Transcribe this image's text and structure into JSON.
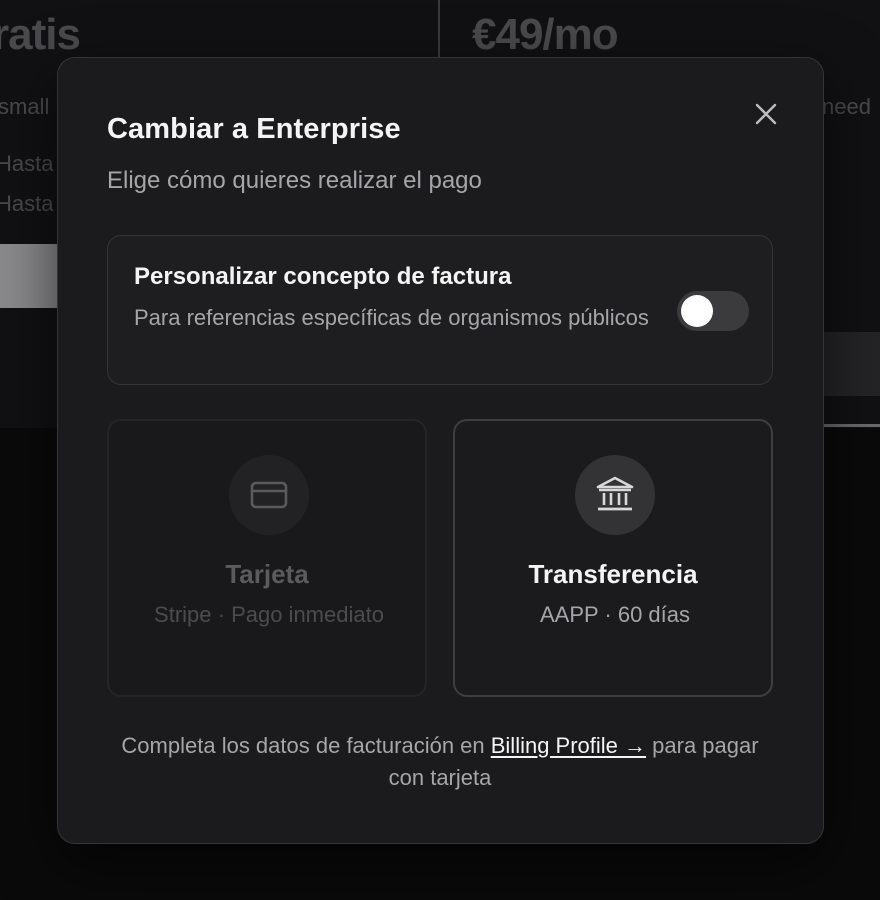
{
  "background": {
    "left_price": "ratis",
    "right_price": "€49/mo",
    "left_line1": "small",
    "left_line2": "Hasta",
    "left_line3": "Hasta",
    "right_line1": "need"
  },
  "modal": {
    "title": "Cambiar a Enterprise",
    "subtitle": "Elige cómo quieres realizar el pago",
    "close_icon": "close-icon",
    "toggle": {
      "title": "Personalizar concepto de factura",
      "description": "Para referencias específicas de organismos públicos",
      "enabled": false
    },
    "options": [
      {
        "icon": "credit-card-icon",
        "title": "Tarjeta",
        "subtitle": "Stripe · Pago inmediato",
        "disabled": true
      },
      {
        "icon": "bank-icon",
        "title": "Transferencia",
        "subtitle": "AAPP · 60 días",
        "disabled": false
      }
    ],
    "footer": {
      "before": "Completa los datos de facturación en ",
      "link": "Billing Profile →",
      "after": " para pagar con tarjeta"
    }
  },
  "colors": {
    "overlay_bg": "#0a0a0b",
    "modal_bg": "#1b1b1d",
    "border": "#353537",
    "text_primary": "#f4f4f5",
    "text_secondary": "#a6a6a9",
    "text_disabled": "#5b5b5e"
  }
}
